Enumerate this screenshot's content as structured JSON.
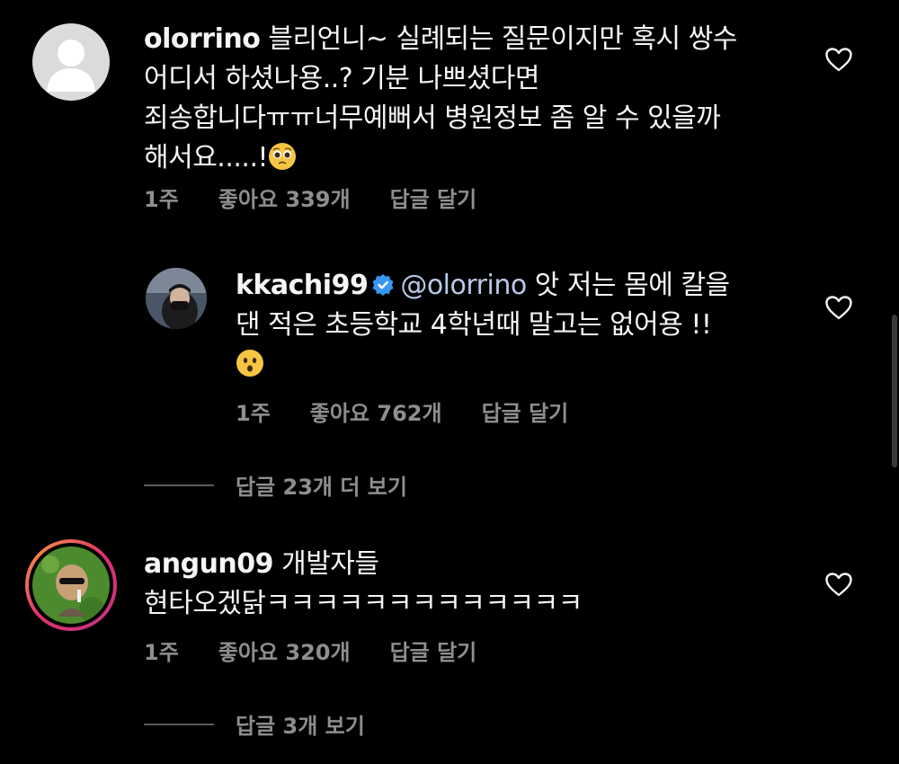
{
  "comments": [
    {
      "username": "olorrino",
      "lines": [
        "블리언니~ 실례되는 질문이지만 혹시 쌍수",
        "어디서 하셨나용..? 기분 나쁘셨다면",
        "죄송합니다ㅠㅠ너무예뻐서 병원정보 좀 알 수 있을까",
        "해서요.....!"
      ],
      "emoji": "pleading-face",
      "time": "1주",
      "likes": "좋아요 339개",
      "reply": "답글 달기"
    },
    {
      "username": "kkachi99",
      "verified": true,
      "mention": "@olorrino",
      "lines": [
        "앗 저는 몸에 칼을",
        "댄 적은 초등학교 4학년때 말고는 없어용 !!"
      ],
      "emoji": "hushed-face",
      "time": "1주",
      "likes": "좋아요 762개",
      "reply": "답글 달기"
    },
    {
      "username": "angun09",
      "lines": [
        "개발자들",
        "현타오겠닭ㅋㅋㅋㅋㅋㅋㅋㅋㅋㅋㅋㅋㅋ"
      ],
      "time": "1주",
      "likes": "좋아요 320개",
      "reply": "답글 달기"
    }
  ],
  "view_replies": [
    "답글 23개 더 보기",
    "답글 3개 보기"
  ],
  "icons": {
    "like": "heart-outline-icon",
    "verified": "verified-badge-icon"
  },
  "colors": {
    "background": "#000000",
    "text": "#f5f5f5",
    "muted": "#8e8e8e",
    "verified": "#3897f0",
    "story_ring": "#c13584"
  }
}
